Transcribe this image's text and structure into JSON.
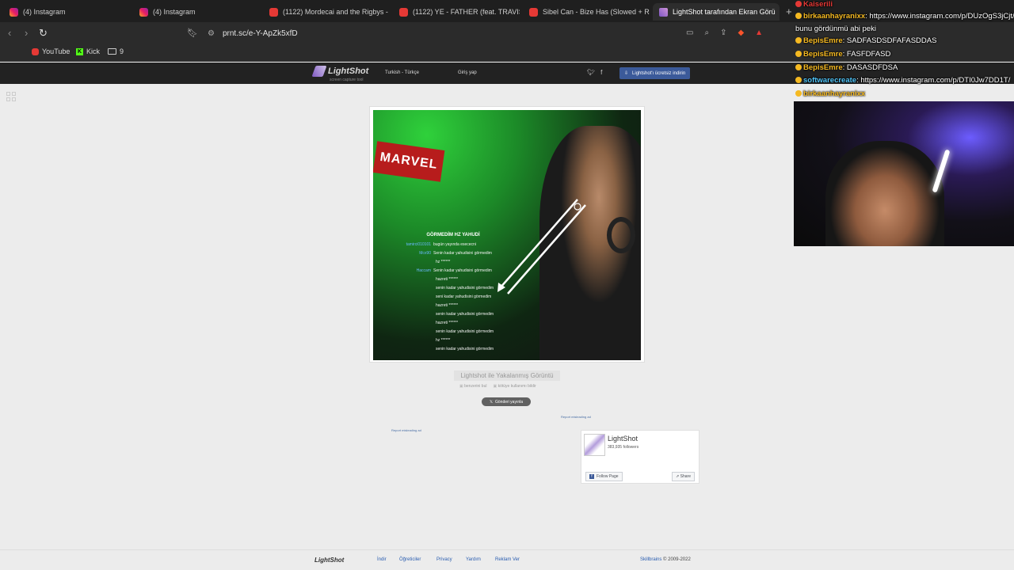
{
  "browser": {
    "tabs": [
      {
        "title": "(4) Instagram",
        "icon": "instagram-icon"
      },
      {
        "title": "(4) Instagram",
        "icon": "instagram-icon"
      },
      {
        "title": "(1122) Mordecai and the Rigbys - Pa",
        "icon": "youtube-icon"
      },
      {
        "title": "(1122) YE - FATHER (feat. TRAVIS SCO",
        "icon": "youtube-icon"
      },
      {
        "title": "Sibel Can - Bize Has (Slowed + Rever",
        "icon": "youtube-icon"
      },
      {
        "title": "LightShot tarafından Ekran Görü",
        "icon": "lightshot-icon",
        "active": true
      }
    ],
    "url": "prnt.sc/e-Y-ApZk5xfD",
    "bookmarks": [
      {
        "label": "YouTube",
        "icon": "youtube-icon"
      },
      {
        "label": "Kick",
        "icon": "kick-icon"
      },
      {
        "label": "9",
        "icon": "folder-icon"
      }
    ]
  },
  "lightshot": {
    "header": {
      "logo": "LightShot",
      "tagline": "screen capture tool",
      "language": "Turkish - Türkçe",
      "login": "Giriş yap",
      "download": "Lightshot'ı ücretsiz indirin"
    },
    "screenshot": {
      "chat_title": "GÖRMEDİM HZ YAHUDİ",
      "chat_rows": [
        {
          "user": "tamirci010101",
          "message": "bugün yayında esececni"
        },
        {
          "user": "Mcx90",
          "message": "Senin kadar yahudisini görmedim"
        },
        {
          "user": "",
          "message": "hz ******"
        },
        {
          "user": "Haccam",
          "message": "Senin kadar yahudisini görmedim"
        },
        {
          "user": "",
          "message": "hazreti ******"
        },
        {
          "user": "",
          "message": "senin kadar yahudisini görmedim"
        },
        {
          "user": "",
          "message": "seni kadar yahudisini görmedim"
        },
        {
          "user": "",
          "message": "hazreti ******"
        },
        {
          "user": "",
          "message": "senin kadar yahudisini görmedim"
        },
        {
          "user": "",
          "message": "hazreti ******"
        },
        {
          "user": "",
          "message": "senin kadar yahudisini görmedim"
        },
        {
          "user": "",
          "message": "hz ******"
        },
        {
          "user": "",
          "message": "senin kadar yahudisini görmedim"
        }
      ]
    },
    "caption": "Lightshot ile Yakalanmış Görüntü",
    "find_similar": "benzerini bul",
    "report_abuse": "kötüye kullanımı bildir",
    "tweet": "Gönderi yayınla",
    "report_ad": "Report misleading ad",
    "facebook": {
      "page_name": "LightShot",
      "followers": "383,935 followers",
      "follow": "Follow Page",
      "share": "Share"
    },
    "footer": {
      "logo": "LightShot",
      "links": [
        "İndir",
        "Öğreticiler",
        "Privacy",
        "Yardım",
        "Reklam Ver"
      ],
      "company": "Skillbrains",
      "copyright": "© 2009-2022"
    }
  },
  "stream_chat": [
    {
      "user": "Kaiserili",
      "message": "",
      "color": "#e53935"
    },
    {
      "user": "birkaanhayranixx",
      "message": ": https://www.instagram.com/p/DUzOgS3jCjt/",
      "color": "#f5b921"
    },
    {
      "user": "",
      "message": "bunu gördünmü abi peki",
      "color": "#ffffff"
    },
    {
      "user": "BepisEmre",
      "message": ": SADFASDSDFAFASDDAS",
      "color": "#f5b921"
    },
    {
      "user": "BepisEmre",
      "message": ": FASFDFASD",
      "color": "#f5b921"
    },
    {
      "user": "BepisEmre",
      "message": ": DASASDFDSA",
      "color": "#f5b921"
    },
    {
      "user": "softwarecreate",
      "message": ": https://www.instagram.com/p/DTI0Jw7DD1T/",
      "color": "#4fc3f7"
    },
    {
      "user": "birkaanhayranixx",
      "message": "",
      "color": "#f5b921"
    }
  ]
}
